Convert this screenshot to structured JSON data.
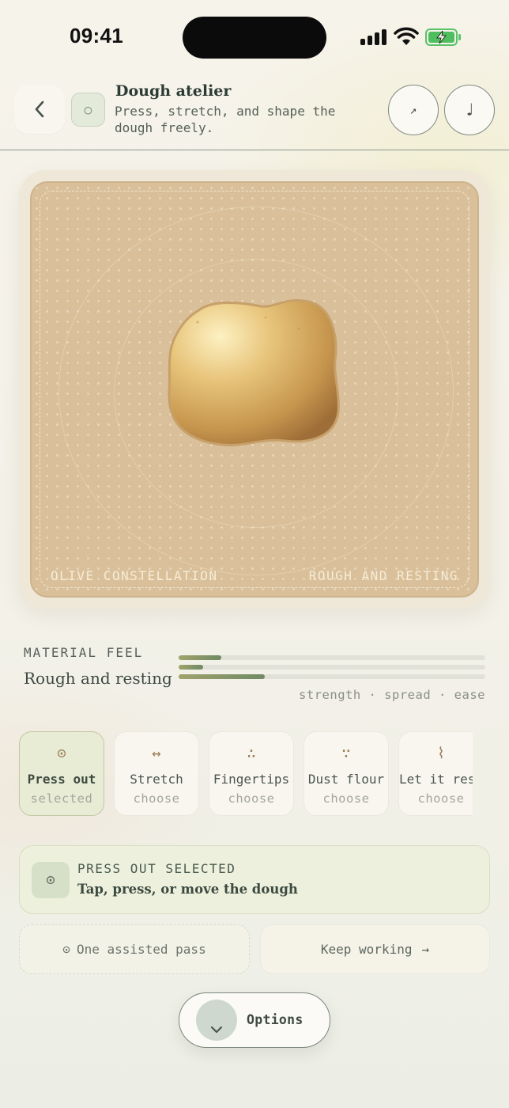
{
  "status_bar": {
    "time": "09:41"
  },
  "header": {
    "title": "Dough atelier",
    "subtitle": "Press, stretch, and shape the dough freely.",
    "badge_glyph": "○",
    "share_glyph": "↗",
    "sound_glyph": "♩"
  },
  "canvas": {
    "label_left": "OLIVE CONSTELLATION",
    "label_right": "ROUGH AND RESTING"
  },
  "material_feel": {
    "label": "MATERIAL FEEL",
    "value": "Rough and resting",
    "meters": [
      {
        "name": "strength",
        "fraction": 0.14
      },
      {
        "name": "spread",
        "fraction": 0.08
      },
      {
        "name": "ease",
        "fraction": 0.28
      }
    ],
    "legend": "strength · spread · ease"
  },
  "tools": [
    {
      "icon": "⊙",
      "name": "Press out",
      "state": "selected"
    },
    {
      "icon": "↔",
      "name": "Stretch",
      "state": "choose"
    },
    {
      "icon": "∴",
      "name": "Fingertips",
      "state": "choose"
    },
    {
      "icon": "∵",
      "name": "Dust flour",
      "state": "choose"
    },
    {
      "icon": "⌇",
      "name": "Let it rest",
      "state": "choose"
    }
  ],
  "selected_card": {
    "icon": "⊙",
    "heading": "PRESS OUT SELECTED",
    "instruction": "Tap, press, or move the dough"
  },
  "actions": {
    "assist_icon": "⊙",
    "assist_label": "One assisted pass",
    "keep_label": "Keep working",
    "keep_arrow": "→"
  },
  "options": {
    "label": "Options"
  },
  "colors": {
    "accent": "#6f8a64",
    "board": "#d9c09a",
    "dough": "#d7a95e"
  }
}
